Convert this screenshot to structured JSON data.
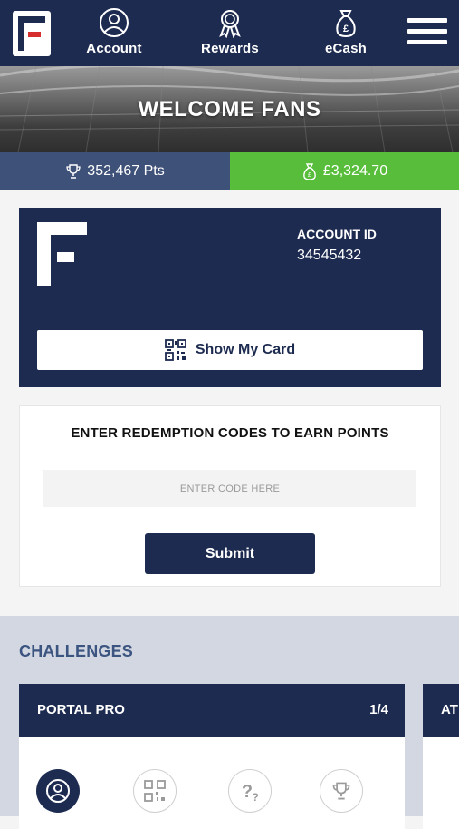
{
  "nav": {
    "items": [
      {
        "label": "Account",
        "icon": "user-circle-icon"
      },
      {
        "label": "Rewards",
        "icon": "award-ribbon-icon"
      },
      {
        "label": "eCash",
        "icon": "money-bag-icon"
      }
    ],
    "menu_icon": "hamburger-menu-icon"
  },
  "hero": {
    "title": "WELCOME FANS"
  },
  "stats": {
    "points": "352,467 Pts",
    "ecash": "£3,324.70"
  },
  "account_card": {
    "account_id_label": "ACCOUNT ID",
    "account_id": "34545432",
    "show_card_label": "Show My Card"
  },
  "redemption": {
    "title": "ENTER REDEMPTION CODES TO EARN POINTS",
    "placeholder": "ENTER CODE HERE",
    "submit_label": "Submit"
  },
  "challenges": {
    "title": "CHALLENGES",
    "cards": [
      {
        "name": "PORTAL PRO",
        "progress": "1/4",
        "steps": [
          "user-icon",
          "qr-code-icon",
          "question-icon",
          "trophy-icon"
        ]
      },
      {
        "name": "AT",
        "progress": ""
      }
    ]
  },
  "colors": {
    "navy": "#1d2b50",
    "points_bar": "#3e5178",
    "ecash_bar": "#57bd3a",
    "challenges_bg": "#d2d7e2",
    "challenges_title": "#3b5480",
    "logo_red": "#d62d2d"
  }
}
